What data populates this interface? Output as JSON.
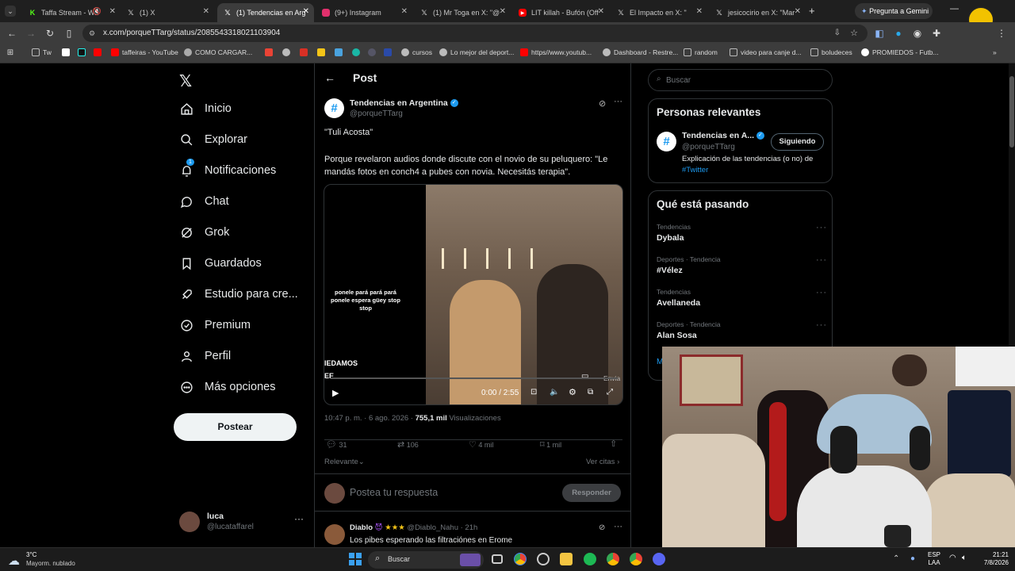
{
  "tabs": [
    {
      "title": "Taffa Stream - Wa",
      "color": "#53fc18",
      "icon": "kick-icon"
    },
    {
      "title": "(1) X",
      "color": "#ffffff",
      "icon": "x-icon"
    },
    {
      "title": "(1) Tendencias en Arg",
      "color": "#ffffff",
      "icon": "x-icon"
    },
    {
      "title": "(9+) Instagram",
      "color": "#e1306c",
      "icon": "instagram-icon"
    },
    {
      "title": "(1) Mr Toga en X: \"@",
      "color": "#ffffff",
      "icon": "x-icon"
    },
    {
      "title": "LIT killah - Bufón (Off",
      "color": "#ff0000",
      "icon": "youtube-icon"
    },
    {
      "title": "El Impacto en X: \"",
      "color": "#ffffff",
      "icon": "x-icon"
    },
    {
      "title": "jesicocirio en X: \"Mar",
      "color": "#ffffff",
      "icon": "x-icon"
    }
  ],
  "gemini_button": "Pregunta a Gemini",
  "url": "x.com/porqueTTarg/status/2085543318021103904",
  "bookmarks": [
    "Tw",
    "taffeiras - YouTube",
    "COMO CARGAR...",
    "cursos",
    "Lo mejor del deport...",
    "https//www.youtub...",
    "Dashboard - Restre...",
    "random",
    "video para canje d...",
    "boludeces",
    "PROMIEDOS - Futb..."
  ],
  "nav": {
    "items": [
      "Inicio",
      "Explorar",
      "Notificaciones",
      "Chat",
      "Grok",
      "Guardados",
      "Estudio para cre...",
      "Premium",
      "Perfil",
      "Más opciones"
    ],
    "notif_badge": "1",
    "post_button": "Postear",
    "user_name": "luca",
    "user_handle": "@lucataffarel"
  },
  "post": {
    "header": "Post",
    "author_name": "Tendencias en Argentina",
    "author_handle": "@porqueTTarg",
    "text_1": "\"Tuli Acosta\"",
    "text_2": "Porque revelaron audios donde discute con el novio de su peluquero: \"Le mandás fotos en conch4 a pubes con novia. Necesitás terapia\".",
    "video_caption": "ponele pará pará pará ponele espera güey stop stop",
    "video_overlay_1": "IEDAMOS",
    "video_overlay_2": "EE",
    "video_time": "0:00 / 2:55",
    "video_envia": "Envia",
    "timestamp": "10:47 p. m. · 6 ago. 2026 ·",
    "views_count": "755,1 mil",
    "views_label": "Visualizaciones",
    "replies": "31",
    "reposts": "106",
    "likes": "4 mil",
    "bookmarks": "1 mil",
    "sort_label": "Relevante",
    "quotes_label": "Ver citas",
    "reply_placeholder": "Postea tu respuesta",
    "reply_button": "Responder"
  },
  "reply_preview": {
    "name": "Diablo",
    "handle": "@Diablo_Nahu · 21h",
    "text": "Los pibes esperando las filtraciónes en Erome"
  },
  "sidebar": {
    "search_placeholder": "Buscar",
    "relevant_title": "Personas relevantes",
    "relevant_name": "Tendencias en A...",
    "relevant_handle": "@porqueTTarg",
    "follow_button": "Siguiendo",
    "relevant_bio": "Explicación de las tendencias (o no) de",
    "relevant_bio_link": "#Twitter",
    "trends_title": "Qué está pasando",
    "trends": [
      {
        "category": "Tendencias",
        "name": "Dybala"
      },
      {
        "category": "Deportes · Tendencia",
        "name": "#Vélez"
      },
      {
        "category": "Tendencias",
        "name": "Avellaneda"
      },
      {
        "category": "Deportes · Tendencia",
        "name": "Alan Sosa"
      }
    ],
    "show_more": "M"
  },
  "taskbar": {
    "temp": "3°C",
    "weather": "Mayorm. nublado",
    "search": "Buscar",
    "lang_1": "ESP",
    "lang_2": "LAA",
    "time": "21:21",
    "date": "7/8/2026"
  },
  "colors": {
    "accent": "#1d9bf0",
    "verified": "#1d9bf0",
    "bg": "#000000",
    "border": "#2f3336"
  }
}
